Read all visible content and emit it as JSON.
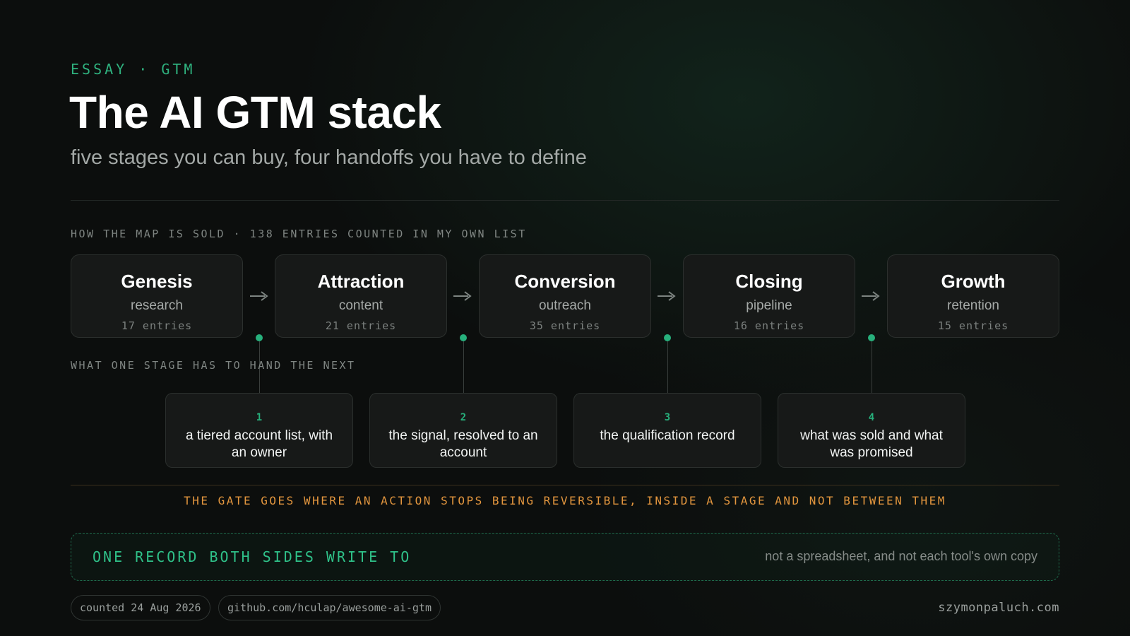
{
  "header": {
    "kicker": "ESSAY · GTM",
    "title": "The AI GTM stack",
    "subtitle": "five stages you can buy, four handoffs you have to define"
  },
  "map_label": "HOW THE MAP IS SOLD · 138 ENTRIES COUNTED IN MY OWN LIST",
  "stages": [
    {
      "name": "Genesis",
      "sub": "research",
      "count": "17 entries"
    },
    {
      "name": "Attraction",
      "sub": "content",
      "count": "21 entries"
    },
    {
      "name": "Conversion",
      "sub": "outreach",
      "count": "35 entries"
    },
    {
      "name": "Closing",
      "sub": "pipeline",
      "count": "16 entries"
    },
    {
      "name": "Growth",
      "sub": "retention",
      "count": "15 entries"
    }
  ],
  "handoff_label": "WHAT ONE STAGE HAS TO HAND THE NEXT",
  "handoffs": [
    {
      "num": "1",
      "text": "a tiered account list, with an owner"
    },
    {
      "num": "2",
      "text": "the signal, resolved to an account"
    },
    {
      "num": "3",
      "text": "the qualification record"
    },
    {
      "num": "4",
      "text": "what was sold and what was promised"
    }
  ],
  "gate_note": "THE GATE GOES WHERE AN ACTION STOPS BEING REVERSIBLE, INSIDE A STAGE AND NOT BETWEEN THEM",
  "record": {
    "title": "ONE RECORD BOTH SIDES WRITE TO",
    "note": "not a spreadsheet, and not each tool's own copy"
  },
  "footer": {
    "date": "counted 24 Aug 2026",
    "repo": "github.com/hculap/awesome-ai-gtm",
    "site": "szymonpaluch.com"
  },
  "colors": {
    "accent": "#27b07c",
    "warning": "#e3963e",
    "background": "#0c0e0d",
    "card": "#171918"
  },
  "icons": {
    "flow": "arrow-right-icon",
    "connector": "dot-icon"
  }
}
